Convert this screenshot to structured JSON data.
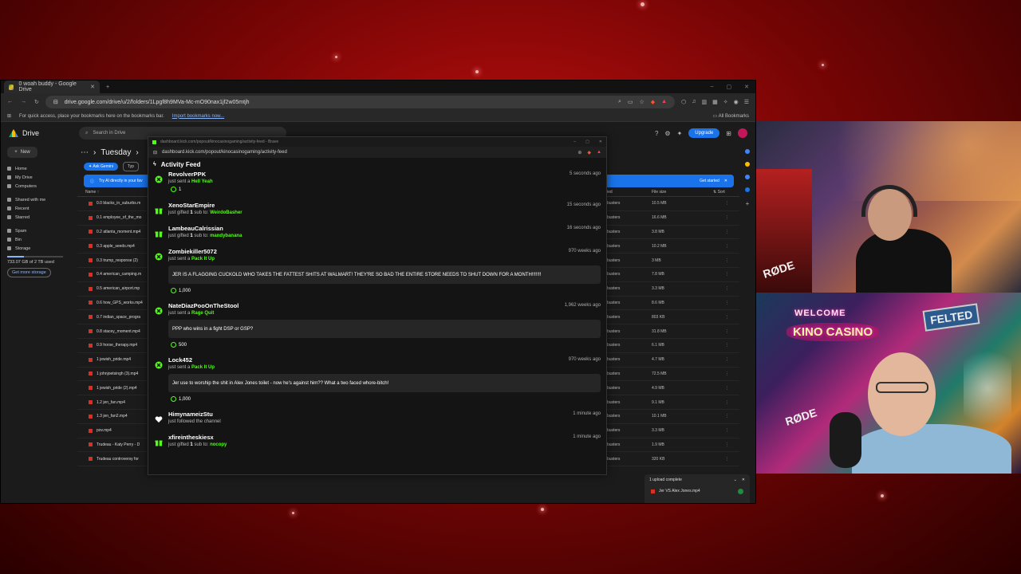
{
  "browser": {
    "tab_title": "0 woah buddy - Google Drive",
    "url": "drive.google.com/drive/u/2/folders/1Lpgf8h9MVa-Mc-mO90nax1jf2w05mtjh",
    "bookmarks_hint": "For quick access, place your bookmarks here on the bookmarks bar.",
    "import_link": "Import bookmarks now...",
    "all_bookmarks": "All Bookmarks"
  },
  "drive": {
    "app_name": "Drive",
    "search_placeholder": "Search in Drive",
    "upgrade_label": "Upgrade",
    "new_label": "New",
    "nav": [
      "Home",
      "My Drive",
      "Computers"
    ],
    "nav2": [
      "Shared with me",
      "Recent",
      "Starred"
    ],
    "nav3": [
      "Spam",
      "Bin",
      "Storage"
    ],
    "storage_text": "733.07 GB of 2 TB used",
    "get_more": "Get more storage",
    "breadcrumb": "Tuesday",
    "ask_gemini": "Ask Gemini",
    "type_chip": "Typ",
    "banner_text": "Try AI directly in your fav",
    "banner_cta": "Get started",
    "col_name": "Name",
    "col_location": "ied",
    "col_size": "File size",
    "col_sort": "Sort",
    "files": [
      {
        "name": "0.0 blacks_in_suburbs.m",
        "location": "busters",
        "size": "10.5 MB"
      },
      {
        "name": "0.1 employee_of_the_mo",
        "location": "busters",
        "size": "16.6 MB"
      },
      {
        "name": "0.2 atlanta_moment.mp4",
        "location": "busters",
        "size": "3.8 MB"
      },
      {
        "name": "0.3 apple_seeds.mp4",
        "location": "busters",
        "size": "10.2 MB"
      },
      {
        "name": "0.3 trump_response (2)",
        "location": "busters",
        "size": "3 MB"
      },
      {
        "name": "0.4 american_camping.m",
        "location": "busters",
        "size": "7.8 MB"
      },
      {
        "name": "0.5 american_airport.mp",
        "location": "busters",
        "size": "3.3 MB"
      },
      {
        "name": "0.6 how_GPS_works.mp4",
        "location": "busters",
        "size": "8.6 MB"
      },
      {
        "name": "0.7 indian_space_progra",
        "location": "busters",
        "size": "803 KB"
      },
      {
        "name": "0.8 stacey_moment.mp4",
        "location": "busters",
        "size": "31.8 MB"
      },
      {
        "name": "0.9 horse_therapy.mp4",
        "location": "busters",
        "size": "6.1 MB"
      },
      {
        "name": "1 jewish_pride.mp4",
        "location": "busters",
        "size": "4.7 MB"
      },
      {
        "name": "1 johnjoetsingh (3).mp4",
        "location": "busters",
        "size": "72.5 MB"
      },
      {
        "name": "1 jewish_pride (2).mp4",
        "location": "busters",
        "size": "4.9 MB"
      },
      {
        "name": "1.2 jen_fan.mp4",
        "location": "busters",
        "size": "9.1 MB"
      },
      {
        "name": "1.3 jen_fan2.mp4",
        "location": "busters",
        "size": "10.1 MB"
      },
      {
        "name": "pov.mp4",
        "location": "busters",
        "size": "3.3 MB"
      },
      {
        "name": "Trudeau - Katy Perry - D",
        "location": "busters",
        "size": "1.9 MB"
      },
      {
        "name": "Trudeau controversy for",
        "location": "busters",
        "size": "320 KB"
      }
    ],
    "upload_title": "1 upload complete",
    "upload_file": "Jer VS Alex Jones.mp4"
  },
  "popout": {
    "window_title": "dashboard.kick.com/popout/kinocasinogaming/activity-feed - Brave",
    "url": "dashboard.kick.com/popout/kinocasinogaming/activity-feed",
    "heading": "Activity Feed",
    "accent": "#53fc18",
    "items": [
      {
        "icon": "kick-coin-icon",
        "user": "RevolverPPK",
        "pre": "just sent a",
        "highlight": "Hell Yeah",
        "post": "",
        "time": "5 seconds ago",
        "coins": "1",
        "message": ""
      },
      {
        "icon": "gift-icon",
        "user": "XenoStarEmpire",
        "pre": "just gifted",
        "count": "1",
        "mid": "sub to:",
        "highlight": "WeirdoBasher",
        "time": "15 seconds ago",
        "coins": "",
        "message": ""
      },
      {
        "icon": "gift-icon",
        "user": "LambeauCalrissian",
        "pre": "just gifted",
        "count": "1",
        "mid": "sub to:",
        "highlight": "mandybanana",
        "time": "16 seconds ago",
        "coins": "",
        "message": ""
      },
      {
        "icon": "kick-coin-icon",
        "user": "Zombiekiller5072",
        "pre": "just sent a",
        "highlight": "Pack It Up",
        "time": "970 weeks ago",
        "coins": "1,000",
        "message": "JER IS A FLAGGING CUCKOLD WHO TAKES THE FATTEST SHITS AT WALMART! THEY'RE SO BAD THE ENTIRE STORE NEEDS TO SHUT DOWN FOR A MONTH!!!!!!!"
      },
      {
        "icon": "kick-coin-icon",
        "user": "NateDiazPooOnTheStool",
        "pre": "just sent a",
        "highlight": "Rage Quit",
        "time": "1,962 weeks ago",
        "coins": "500",
        "message": "PPP who wins in a fight DSP or GSP?"
      },
      {
        "icon": "kick-coin-icon",
        "user": "Lock452",
        "pre": "just sent a",
        "highlight": "Pack It Up",
        "time": "970 weeks ago",
        "coins": "1,000",
        "message": "Jer use to worship the shit in Alex Jones toilet - now he's against him?? What a two faced whore-bitch!"
      },
      {
        "icon": "heart-icon",
        "user": "HimynameizStu",
        "pre": "just followed the channel",
        "highlight": "",
        "time": "1 minute ago",
        "coins": "",
        "message": ""
      },
      {
        "icon": "gift-icon",
        "user": "xfireintheskiesx",
        "pre": "just gifted",
        "count": "1",
        "mid": "sub to:",
        "highlight": "nocopy",
        "time": "1 minute ago",
        "coins": "",
        "message": ""
      }
    ]
  },
  "webcam": {
    "sign_welcome": "WELCOME",
    "sign_kino": "KINO CASINO",
    "sign_felted": "FELTED",
    "mic_brand": "RØDE"
  }
}
